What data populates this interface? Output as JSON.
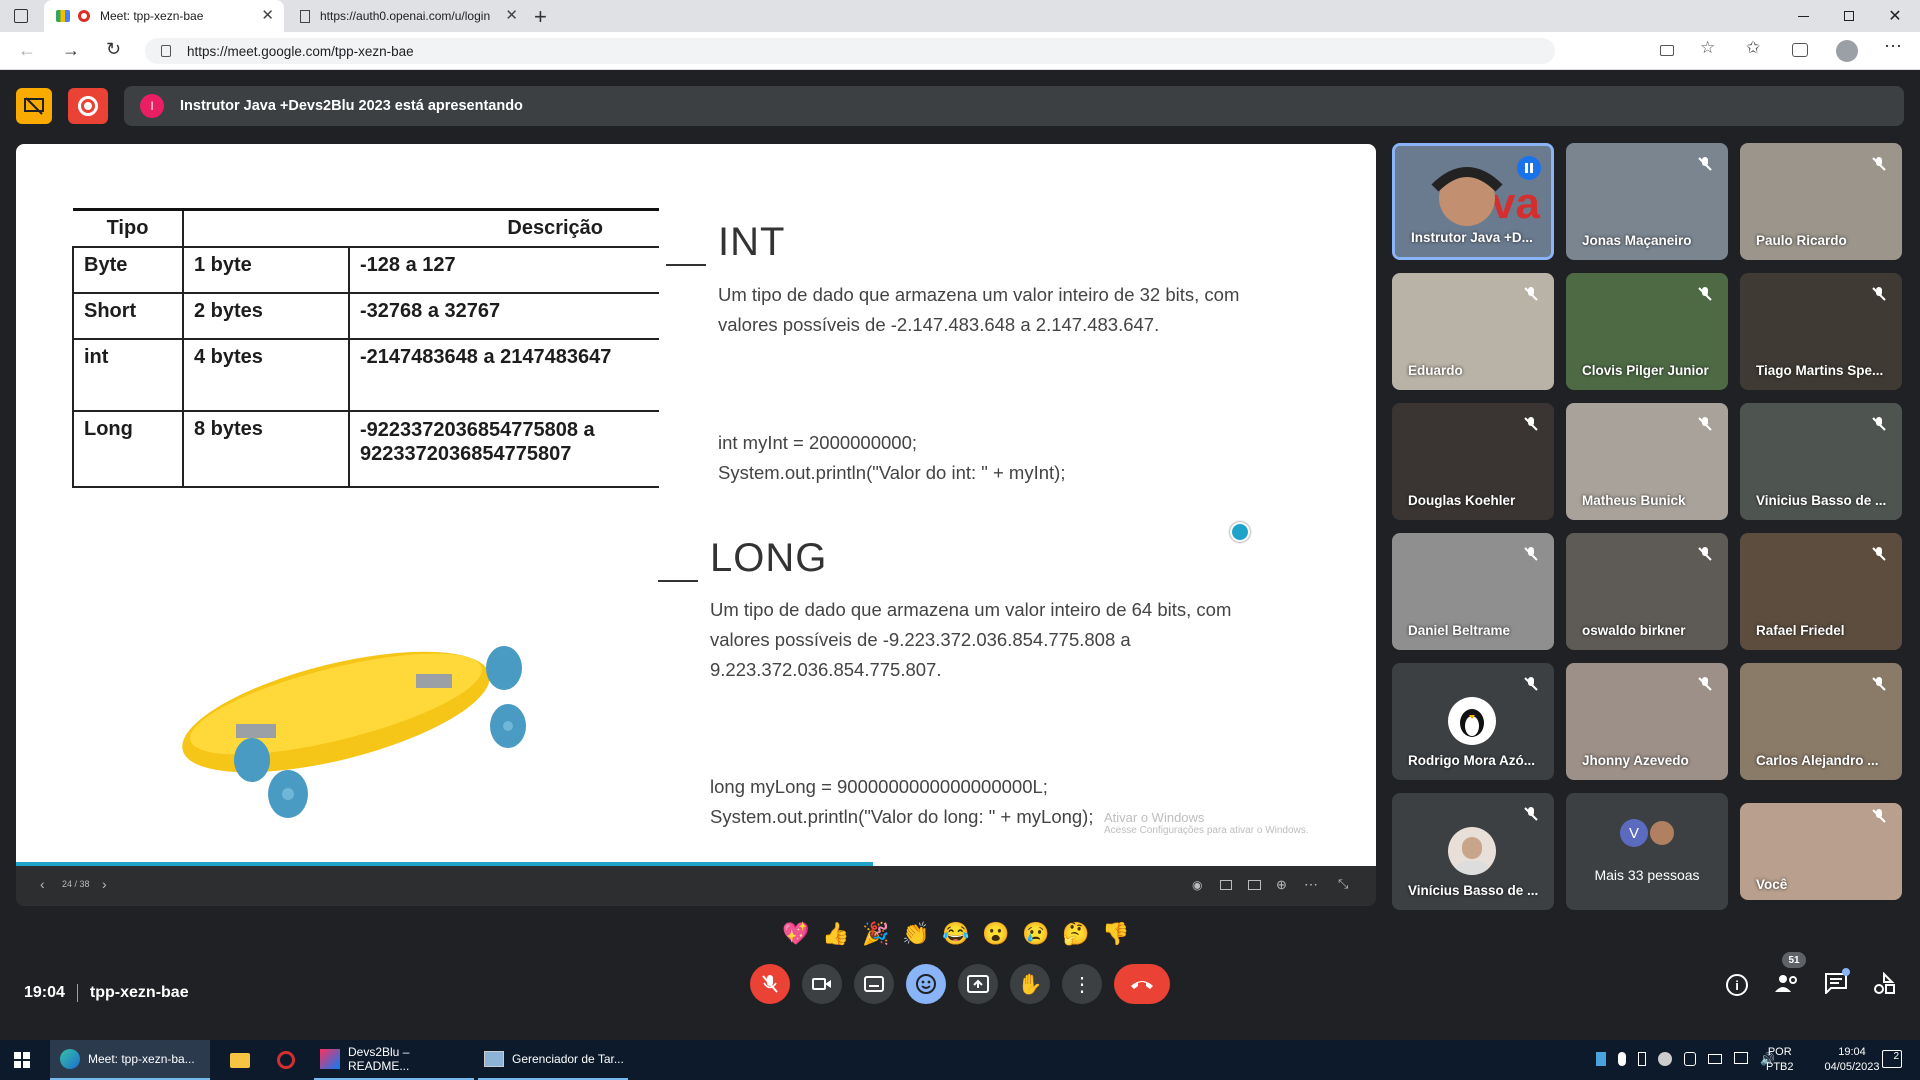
{
  "browser": {
    "tabs": [
      {
        "label": "Meet: tpp-xezn-bae",
        "active": true
      },
      {
        "label": "https://auth0.openai.com/u/login",
        "active": false
      }
    ],
    "url": "https://meet.google.com/tpp-xezn-bae"
  },
  "meet": {
    "presenting_banner": "Instrutor Java +Devs2Blu 2023 está apresentando",
    "presenter_initial": "I",
    "slide": {
      "table": {
        "headers": [
          "Tipo",
          "Descrição"
        ],
        "rows": [
          [
            "Byte",
            "1 byte",
            "-128 a 127"
          ],
          [
            "Short",
            "2 bytes",
            "-32768 a 32767"
          ],
          [
            "int",
            "4 bytes",
            "-2147483648 a 2147483647"
          ],
          [
            "Long",
            "8 bytes",
            "-9223372036854775808 a 9223372036854775807"
          ]
        ]
      },
      "int_title": "INT",
      "int_desc_1": "Um tipo de dado que armazena um valor inteiro de 32 bits, com",
      "int_desc_2": "valores possíveis de -2.147.483.648 a 2.147.483.647.",
      "int_code_1": "int myInt = 2000000000;",
      "int_code_2": "System.out.println(\"Valor do int: \" + myInt);",
      "long_title": "LONG",
      "long_desc_1": "Um tipo de dado que armazena um valor inteiro de 64 bits, com",
      "long_desc_2": "valores possíveis de -9.223.372.036.854.775.808 a",
      "long_desc_3": "9.223.372.036.854.775.807.",
      "long_code_1": "long myLong = 9000000000000000000L;",
      "long_code_2": "System.out.println(\"Valor do long: \" + myLong);",
      "watermark_1": "Ativar o Windows",
      "watermark_2": "Acesse Configurações para ativar o Windows.",
      "page_indicator": "24 / 38",
      "progress": 0.63
    },
    "participants": [
      {
        "name": "Instrutor Java +D...",
        "speaking": true
      },
      {
        "name": "Jonas Maçaneiro"
      },
      {
        "name": "Paulo Ricardo"
      },
      {
        "name": "Eduardo"
      },
      {
        "name": "Clovis Pilger Junior"
      },
      {
        "name": "Tiago Martins Spe..."
      },
      {
        "name": "Douglas Koehler"
      },
      {
        "name": "Matheus Bunick"
      },
      {
        "name": "Vinicius Basso de ..."
      },
      {
        "name": "Daniel Beltrame"
      },
      {
        "name": "oswaldo birkner"
      },
      {
        "name": "Rafael Friedel"
      },
      {
        "name": "Rodrigo Mora Azó..."
      },
      {
        "name": "Jhonny Azevedo"
      },
      {
        "name": "Carlos Alejandro ..."
      },
      {
        "name": "Vinícius Basso de ..."
      },
      {
        "name": "Mais 33 pessoas",
        "avatar_letter": "V"
      },
      {
        "name": "Você"
      }
    ],
    "reactions": [
      "💖",
      "👍",
      "🎉",
      "👏",
      "😂",
      "😮",
      "😢",
      "🤔",
      "👎"
    ],
    "meeting_time": "19:04",
    "meeting_code": "tpp-xezn-bae",
    "participant_count": "51"
  },
  "taskbar": {
    "items": [
      {
        "label": "Meet: tpp-xezn-ba..."
      },
      {
        "label": "Devs2Blu – README..."
      },
      {
        "label": "Gerenciador de Tar..."
      }
    ],
    "lang_1": "POR",
    "lang_2": "PTB2",
    "time": "19:04",
    "date": "04/05/2023",
    "notifications": "2"
  },
  "colors": {
    "meet_bg": "#202124",
    "accent_red": "#ea4335",
    "accent_yellow": "#f9ab00",
    "speaking_blue": "#8ab4f8",
    "progress_teal": "#1fa3c9"
  }
}
